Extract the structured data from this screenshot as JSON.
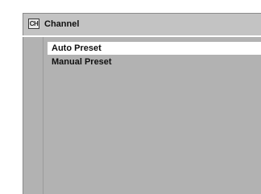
{
  "header": {
    "icon_text": "CH",
    "title": "Channel"
  },
  "menu": {
    "items": [
      {
        "label": "Auto Preset",
        "selected": true
      },
      {
        "label": "Manual Preset",
        "selected": false
      }
    ]
  },
  "colors": {
    "background": "#c3c3c3",
    "panel": "#b2b2b2",
    "highlight": "#ffffff",
    "text": "#111111"
  }
}
